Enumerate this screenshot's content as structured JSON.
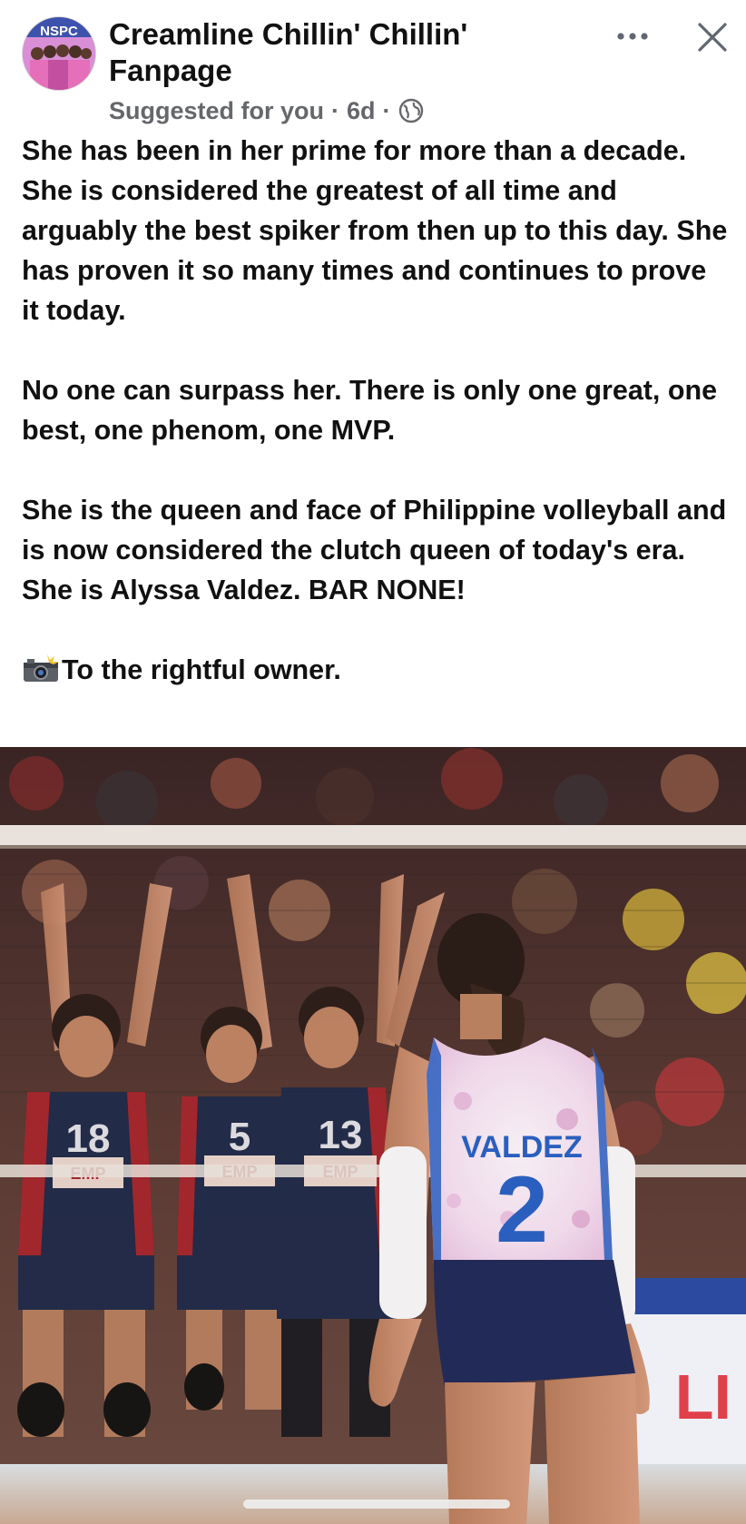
{
  "post": {
    "page_name": "Creamline Chillin' Chillin' Fanpage",
    "suggested_label": "Suggested for you",
    "separator": "·",
    "age": "6d",
    "privacy_icon": "globe-icon",
    "more_icon": "ellipsis-icon",
    "close_icon": "close-icon",
    "avatar_text": "NSPC",
    "paragraphs": [
      "She has been in her prime for more than a decade. She is considered the greatest of all time and arguably the best spiker from then up to this day. She has proven it so many times and continues to prove it today.",
      "No one can surpass her. There is only one great, one best, one phenom, one MVP.",
      "She is the queen and face of Philippine volleyball and is now considered the clutch queen of today's era. She is Alyssa Valdez. BAR NONE!"
    ],
    "credit_icon": "camera-flash-icon",
    "credit_text": "To the rightful owner."
  },
  "photo": {
    "jersey_name": "VALDEZ",
    "jersey_number": "2",
    "opponent_numbers": [
      "18",
      "5",
      "13"
    ],
    "opponent_sponsor": "EMP",
    "banner_text": "LI",
    "colors": {
      "jersey_blue": "#2a5fbf",
      "opponent_navy": "#1e2a4a",
      "opponent_red": "#a8262c"
    }
  }
}
